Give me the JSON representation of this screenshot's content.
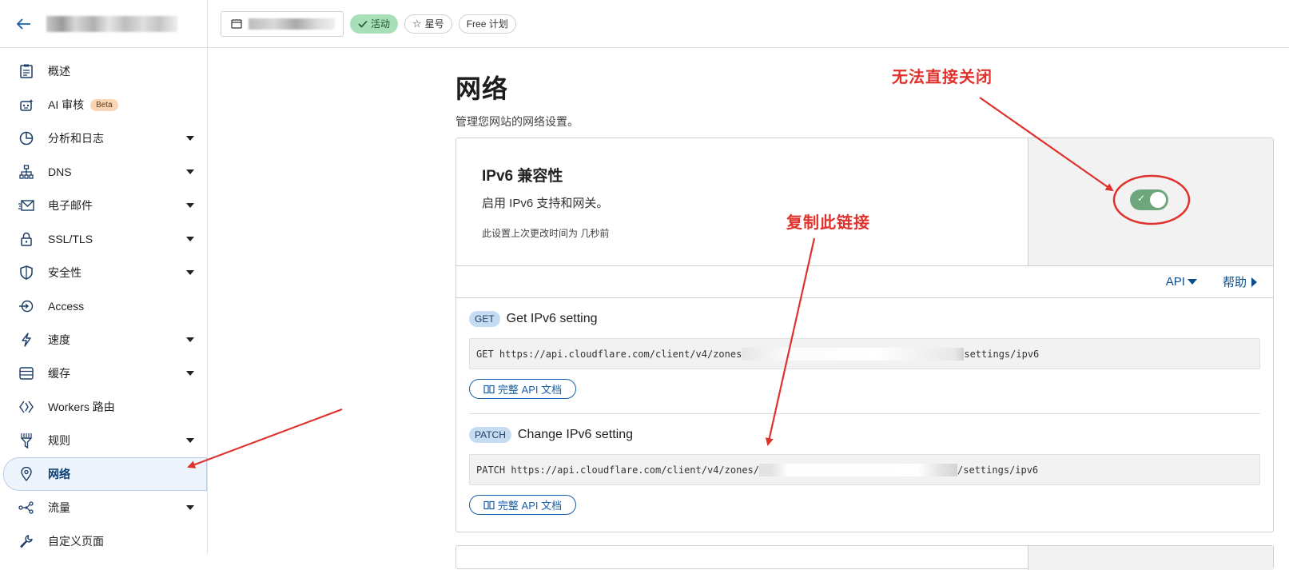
{
  "sidebar": {
    "back_label": "返回",
    "items": [
      {
        "label": "概述",
        "icon": "clipboard-icon",
        "caret": false
      },
      {
        "label": "AI 审核",
        "icon": "robot-icon",
        "caret": false,
        "badge": "Beta"
      },
      {
        "label": "分析和日志",
        "icon": "pie-chart-icon",
        "caret": true
      },
      {
        "label": "DNS",
        "icon": "sitemap-icon",
        "caret": true
      },
      {
        "label": "电子邮件",
        "icon": "mail-icon",
        "caret": true
      },
      {
        "label": "SSL/TLS",
        "icon": "lock-icon",
        "caret": true
      },
      {
        "label": "安全性",
        "icon": "shield-icon",
        "caret": true
      },
      {
        "label": "Access",
        "icon": "access-icon",
        "caret": false
      },
      {
        "label": "速度",
        "icon": "bolt-icon",
        "caret": true
      },
      {
        "label": "缓存",
        "icon": "storage-icon",
        "caret": true
      },
      {
        "label": "Workers 路由",
        "icon": "workers-icon",
        "caret": false
      },
      {
        "label": "规则",
        "icon": "funnel-icon",
        "caret": true
      },
      {
        "label": "网络",
        "icon": "location-pin-icon",
        "caret": false,
        "active": true
      },
      {
        "label": "流量",
        "icon": "share-icon",
        "caret": true
      },
      {
        "label": "自定义页面",
        "icon": "wrench-icon",
        "caret": false
      }
    ]
  },
  "topbar": {
    "status": "活动",
    "star": "星号",
    "plan": "Free 计划"
  },
  "page": {
    "title": "网络",
    "subtitle": "管理您网站的网络设置。"
  },
  "setting": {
    "title": "IPv6 兼容性",
    "description": "启用 IPv6 支持和网关。",
    "updated": "此设置上次更改时间为 几秒前",
    "enabled": true,
    "links": {
      "api": "API",
      "help": "帮助"
    }
  },
  "api_endpoints": [
    {
      "method": "GET",
      "name": "Get IPv6 setting",
      "url_prefix": "GET https://api.cloudflare.com/client/v4/zones",
      "url_suffix": "settings/ipv6",
      "doc_button": "完整 API 文档"
    },
    {
      "method": "PATCH",
      "name": "Change IPv6 setting",
      "url_prefix": "PATCH https://api.cloudflare.com/client/v4/zones/",
      "url_suffix": "/settings/ipv6",
      "doc_button": "完整 API 文档"
    }
  ],
  "annotations": {
    "cannot_close": "无法直接关闭",
    "copy_link": "复制此链接",
    "color": "#e0322d"
  },
  "colors": {
    "accent": "#0a4f8c",
    "toggle_on": "#6fa77d",
    "status_green": "#a8dfb8"
  }
}
